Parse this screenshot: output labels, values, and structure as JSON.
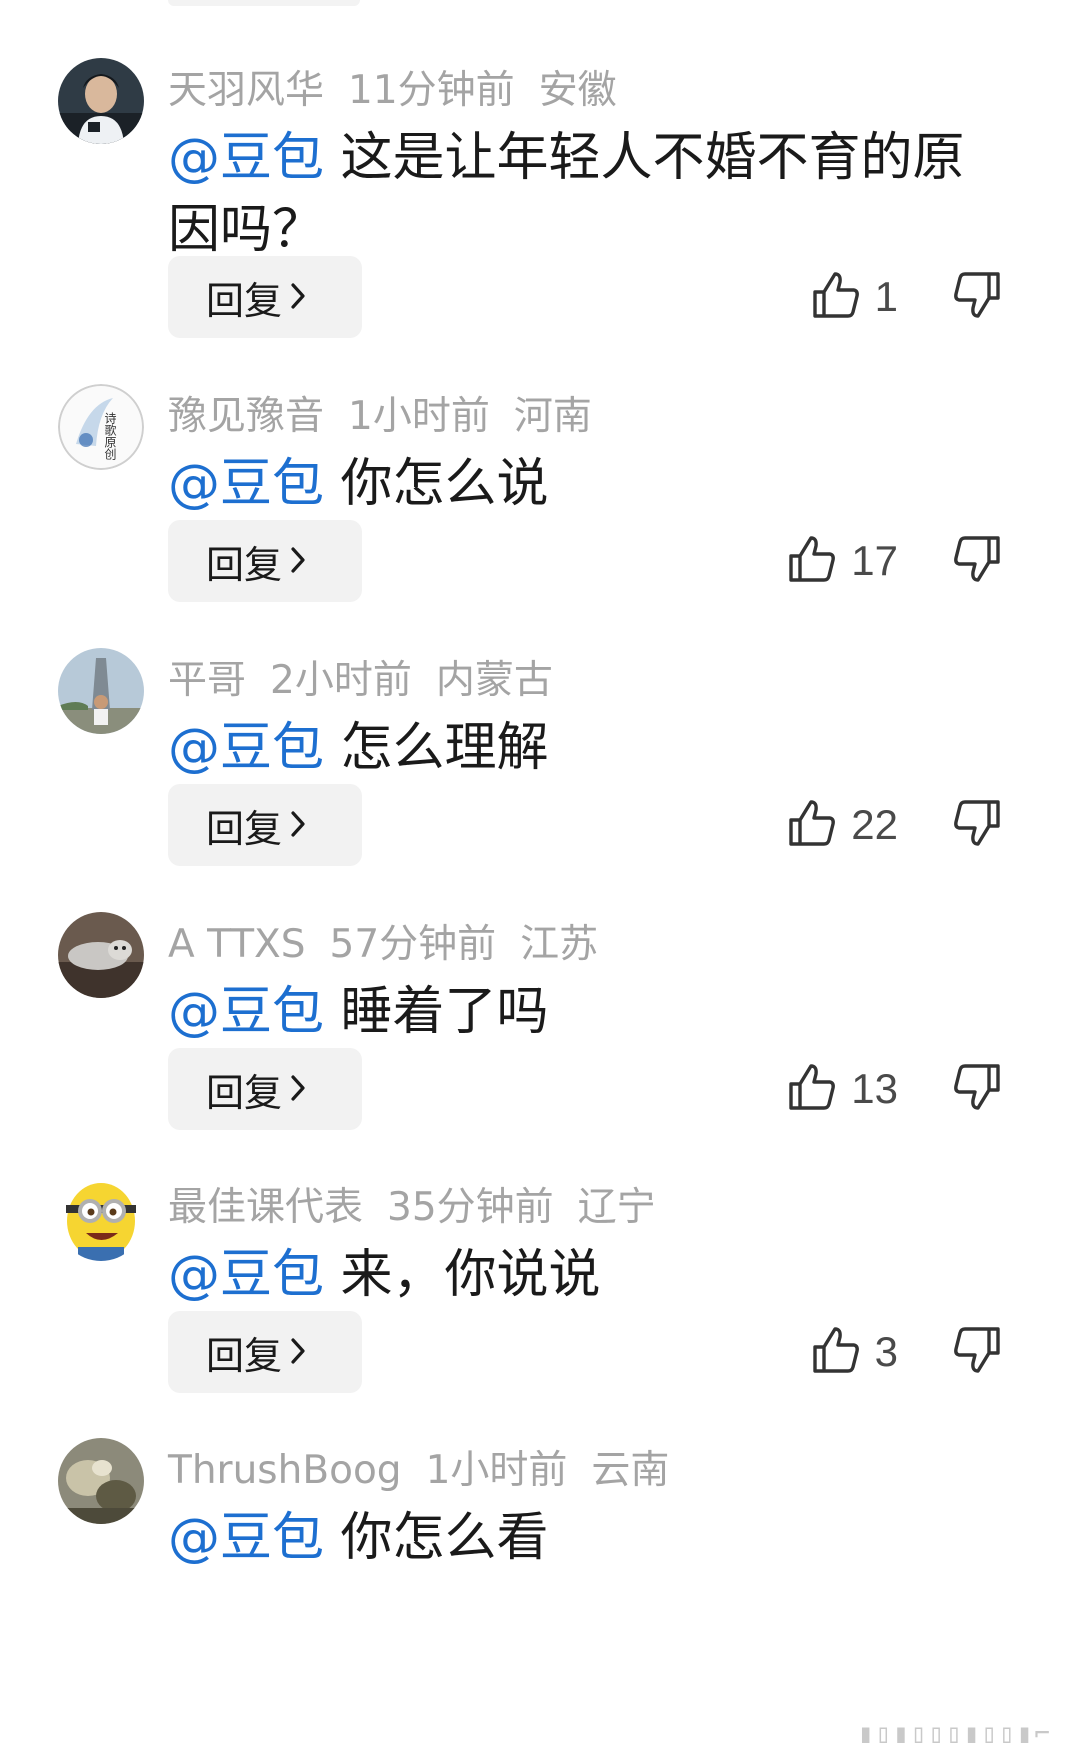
{
  "comments": [
    {
      "username": "天羽风华",
      "time": "11分钟前",
      "location": "安徽",
      "mention": "@豆包",
      "text": "这是让年轻人不婚不育的原因吗？",
      "reply_label": "回复",
      "likes": "1"
    },
    {
      "username": "豫见豫音",
      "time": "1小时前",
      "location": "河南",
      "mention": "@豆包",
      "text": "你怎么说",
      "reply_label": "回复",
      "likes": "17"
    },
    {
      "username": "平哥",
      "time": "2小时前",
      "location": "内蒙古",
      "mention": "@豆包",
      "text": "怎么理解",
      "reply_label": "回复",
      "likes": "22"
    },
    {
      "username": "A TTXS",
      "time": "57分钟前",
      "location": "江苏",
      "mention": "@豆包",
      "text": "睡着了吗",
      "reply_label": "回复",
      "likes": "13"
    },
    {
      "username": "最佳课代表",
      "time": "35分钟前",
      "location": "辽宁",
      "mention": "@豆包",
      "text": "来，你说说",
      "reply_label": "回复",
      "likes": "3"
    },
    {
      "username": "ThrushBoog",
      "time": "1小时前",
      "location": "云南",
      "mention": "@豆包",
      "text": "你怎么看"
    }
  ],
  "avatar_text": {
    "c1": "诗歌原创"
  },
  "colors": {
    "mention": "#1d6fd0",
    "meta": "#a4a4a4",
    "reply_bg": "#f2f2f2"
  },
  "icons": {
    "like": "thumbs-up-icon",
    "dislike": "thumbs-down-icon",
    "reply_chevron": "chevron-right-icon"
  }
}
